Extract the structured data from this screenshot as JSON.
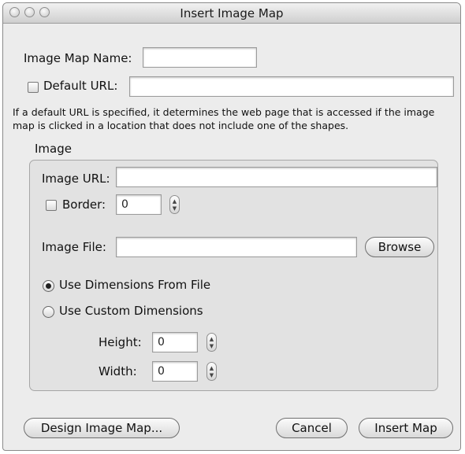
{
  "window": {
    "title": "Insert Image Map"
  },
  "form": {
    "map_name_label": "Image Map Name:",
    "map_name_value": "",
    "default_url_label": "Default URL:",
    "default_url_value": "",
    "note": "If a default URL is specified, it determines the web page that is accessed if the image map is clicked in a location that does not include one of the shapes."
  },
  "image": {
    "group_label": "Image",
    "url_label": "Image URL:",
    "url_value": "",
    "border_label": "Border:",
    "border_value": "0",
    "file_label": "Image File:",
    "file_value": "",
    "browse_label": "Browse",
    "radio_file_label": "Use Dimensions From File",
    "radio_custom_label": "Use Custom Dimensions",
    "selected_dimension_option": "Use Dimensions From File",
    "height_label": "Height:",
    "height_value": "0",
    "width_label": "Width:",
    "width_value": "0"
  },
  "buttons": {
    "design_label": "Design Image Map...",
    "cancel_label": "Cancel",
    "insert_label": "Insert Map"
  }
}
